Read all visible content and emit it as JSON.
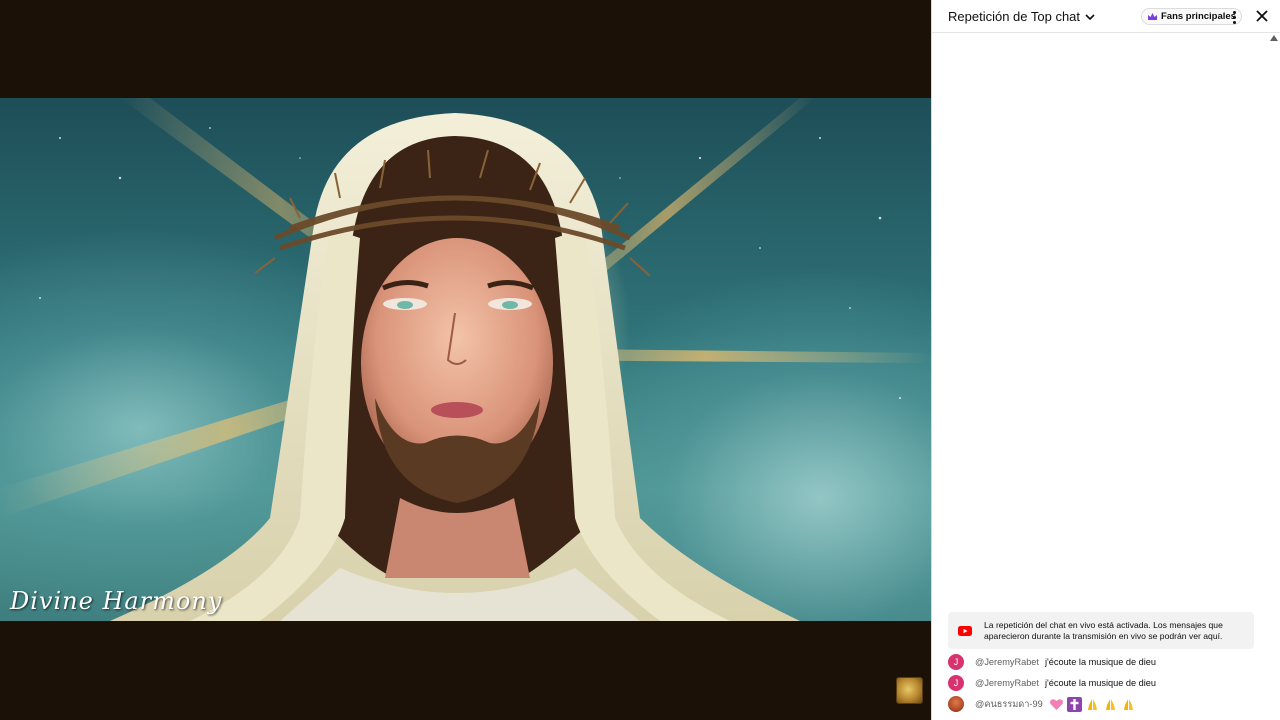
{
  "video": {
    "title_overlay": "Divine Harmony"
  },
  "chat": {
    "mode_label": "Repetición de Top chat",
    "badge_label": "Fans principales",
    "replay_notice": "La repetición del chat en vivo está activada. Los mensajes que aparecieron durante la transmisión en vivo se podrán ver aquí.",
    "messages": [
      {
        "avatar_letter": "J",
        "author": "@JeremyRabet",
        "text": "j'écoute la musique de dieu",
        "avatar_color": "#d8326f"
      },
      {
        "avatar_letter": "J",
        "author": "@JeremyRabet",
        "text": "j'écoute la musique de dieu",
        "avatar_color": "#d8326f"
      },
      {
        "avatar_letter": "",
        "author": "@คนธรรมดา-99",
        "text": "",
        "avatar_color": "#b04a2a",
        "emojis": [
          "heart-emoji",
          "latin-cross-emoji",
          "folded-hands-emoji",
          "folded-hands-emoji",
          "folded-hands-emoji"
        ]
      }
    ]
  },
  "colors": {
    "background": "#1b1107",
    "chat_bg": "#ffffff",
    "badge_crown": "#7b3fe4",
    "youtube_red": "#ff0000"
  }
}
